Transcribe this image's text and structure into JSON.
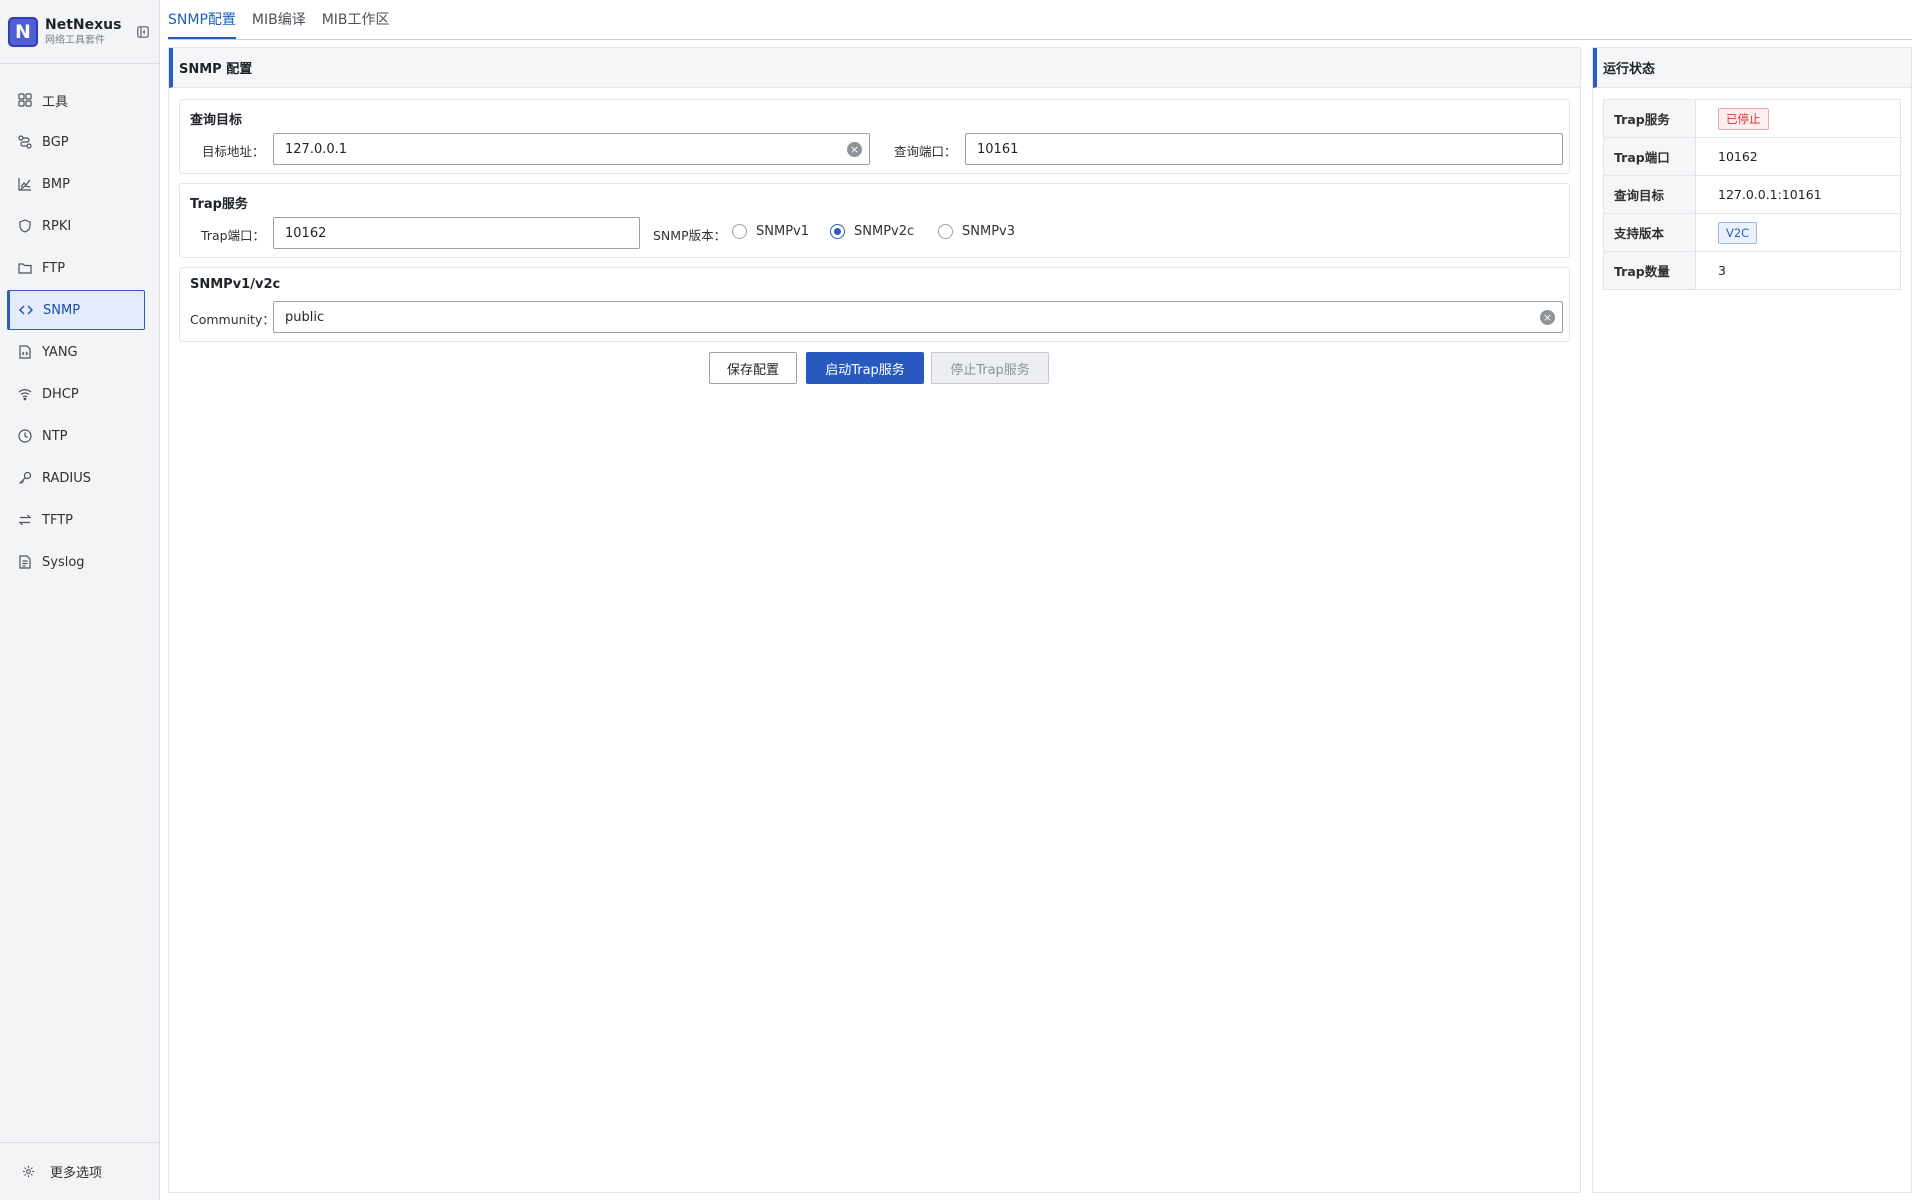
{
  "brand": {
    "name": "NetNexus",
    "subtitle": "网络工具套件",
    "logo_letter": "N"
  },
  "sidebar": {
    "items": [
      {
        "label": "工具",
        "icon": "grid-icon"
      },
      {
        "label": "BGP",
        "icon": "route-icon"
      },
      {
        "label": "BMP",
        "icon": "chart-icon"
      },
      {
        "label": "RPKI",
        "icon": "shield-icon"
      },
      {
        "label": "FTP",
        "icon": "folder-icon"
      },
      {
        "label": "SNMP",
        "icon": "code-icon",
        "active": true
      },
      {
        "label": "YANG",
        "icon": "file-code-icon"
      },
      {
        "label": "DHCP",
        "icon": "wifi-icon"
      },
      {
        "label": "NTP",
        "icon": "clock-icon"
      },
      {
        "label": "RADIUS",
        "icon": "key-icon"
      },
      {
        "label": "TFTP",
        "icon": "swap-icon"
      },
      {
        "label": "Syslog",
        "icon": "document-icon"
      }
    ],
    "more_label": "更多选项"
  },
  "tabs": [
    {
      "label": "SNMP配置",
      "active": true
    },
    {
      "label": "MIB编译"
    },
    {
      "label": "MIB工作区"
    }
  ],
  "main": {
    "title": "SNMP 配置",
    "query_group": {
      "title": "查询目标",
      "target_label": "目标地址：",
      "target_value": "127.0.0.1",
      "port_label": "查询端口：",
      "port_value": "10161"
    },
    "trap_group": {
      "title": "Trap服务",
      "port_label": "Trap端口：",
      "port_value": "10162",
      "version_label": "SNMP版本：",
      "versions": [
        "SNMPv1",
        "SNMPv2c",
        "SNMPv3"
      ],
      "selected_version": "SNMPv2c"
    },
    "community_group": {
      "title": "SNMPv1/v2c",
      "community_label": "Community：",
      "community_value": "public"
    },
    "buttons": {
      "save": "保存配置",
      "start": "启动Trap服务",
      "stop": "停止Trap服务"
    }
  },
  "status": {
    "title": "运行状态",
    "rows": [
      {
        "key": "Trap服务",
        "value": "已停止",
        "type": "tag-danger"
      },
      {
        "key": "Trap端口",
        "value": "10162"
      },
      {
        "key": "查询目标",
        "value": "127.0.0.1:10161"
      },
      {
        "key": "支持版本",
        "value": "V2C",
        "type": "tag-info"
      },
      {
        "key": "Trap数量",
        "value": "3"
      }
    ]
  },
  "colors": {
    "accent": "#2b5cc0",
    "primary_button": "#2759bf",
    "danger": "#d6333b"
  }
}
